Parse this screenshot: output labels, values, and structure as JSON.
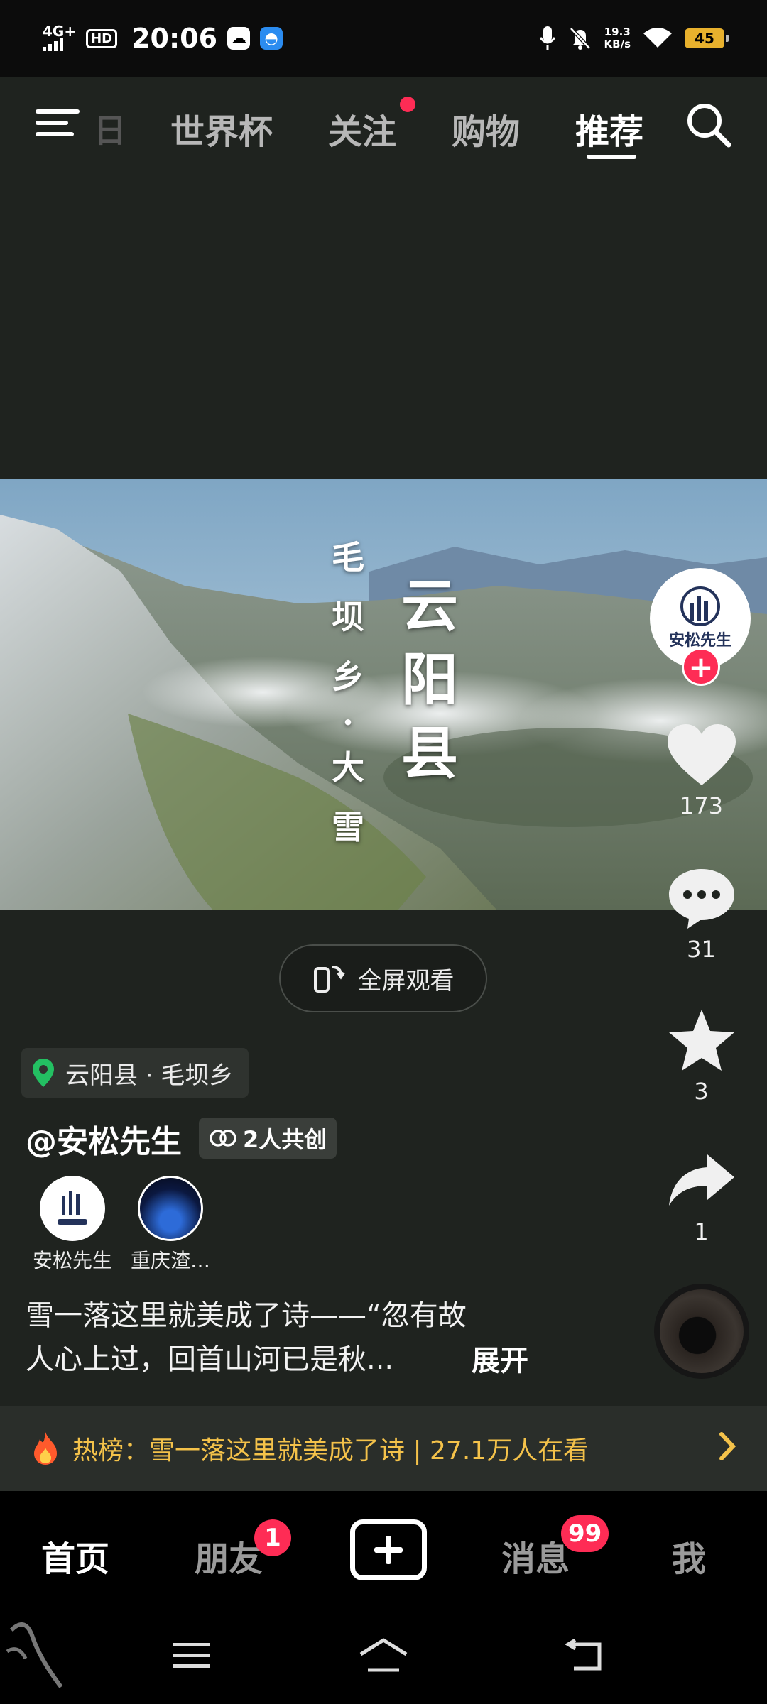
{
  "status_bar": {
    "network": "4G+",
    "hd": "HD",
    "time": "20:06",
    "speed_value": "19.3",
    "speed_unit": "KB/s",
    "battery": "45"
  },
  "top_tabs": {
    "partial": "日",
    "items": [
      "世界杯",
      "关注",
      "购物",
      "推荐"
    ],
    "active": "推荐"
  },
  "video": {
    "title_vertical_a": [
      "毛",
      "坝",
      "乡",
      "·",
      "大",
      "雪"
    ],
    "title_vertical_b": [
      "云",
      "阳",
      "县"
    ]
  },
  "fullscreen_button": "全屏观看",
  "rail": {
    "avatar_text": "安松先生",
    "likes": "173",
    "comments": "31",
    "favorites": "3",
    "shares": "1"
  },
  "location": "云阳县 · 毛坝乡",
  "author": "@安松先生",
  "cocreate": "2人共创",
  "creators": [
    {
      "name": "安松先生"
    },
    {
      "name": "重庆渣…"
    }
  ],
  "description_line1": "雪一落这里就美成了诗——“忽有故",
  "description_line2": "人心上过，回首山河已是秋...",
  "expand": "展开",
  "hot": {
    "text": "热榜：雪一落这里就美成了诗 | 27.1万人在看"
  },
  "bottom_nav": {
    "home": "首页",
    "friends": "朋友",
    "friends_badge": "1",
    "messages": "消息",
    "messages_badge": "99",
    "me": "我"
  },
  "colors": {
    "accent_red": "#fe2c55",
    "hot_yellow": "#f4c24a",
    "background": "#1f231f"
  }
}
